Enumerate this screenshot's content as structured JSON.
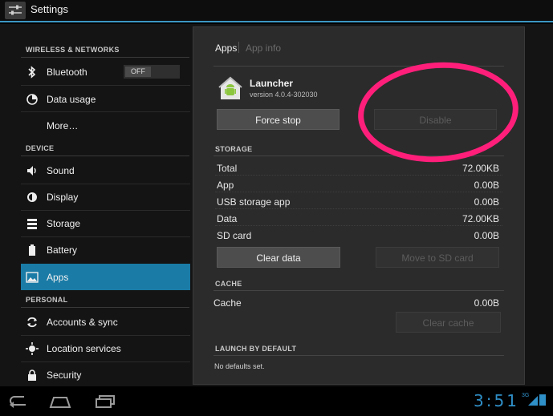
{
  "actionbar": {
    "title": "Settings",
    "icon": "settings-sliders-icon"
  },
  "sidebar": {
    "sections": [
      {
        "header": "WIRELESS & NETWORKS"
      },
      {
        "header": "DEVICE"
      },
      {
        "header": "PERSONAL"
      }
    ],
    "items": [
      {
        "label": "Bluetooth",
        "icon": "bluetooth-icon",
        "toggle": "OFF"
      },
      {
        "label": "Data usage",
        "icon": "data-usage-icon"
      },
      {
        "label": "More…"
      },
      {
        "label": "Sound",
        "icon": "speaker-icon"
      },
      {
        "label": "Display",
        "icon": "display-brightness-icon"
      },
      {
        "label": "Storage",
        "icon": "storage-icon"
      },
      {
        "label": "Battery",
        "icon": "battery-icon"
      },
      {
        "label": "Apps",
        "icon": "apps-icon",
        "selected": true
      },
      {
        "label": "Accounts & sync",
        "icon": "sync-icon"
      },
      {
        "label": "Location services",
        "icon": "location-icon"
      },
      {
        "label": "Security",
        "icon": "lock-icon"
      }
    ]
  },
  "panel": {
    "breadcrumb": {
      "current": "Apps",
      "next": "App info"
    },
    "app": {
      "name": "Launcher",
      "version": "version 4.0.4-302030",
      "icon": "android-launcher-icon"
    },
    "buttons": {
      "force_stop": "Force stop",
      "disable": "Disable"
    },
    "storage": {
      "header": "STORAGE",
      "rows": [
        {
          "label": "Total",
          "value": "72.00KB"
        },
        {
          "label": "App",
          "value": "0.00B"
        },
        {
          "label": "USB storage app",
          "value": "0.00B"
        },
        {
          "label": "Data",
          "value": "72.00KB"
        },
        {
          "label": "SD card",
          "value": "0.00B"
        }
      ],
      "clear_data": "Clear data",
      "move_to_sd": "Move to SD card"
    },
    "cache": {
      "header": "CACHE",
      "label": "Cache",
      "value": "0.00B",
      "clear_cache": "Clear cache"
    },
    "launch": {
      "header": "LAUNCH BY DEFAULT",
      "text": "No defaults set."
    }
  },
  "annotation": {
    "color": "#ff1f7a"
  },
  "systembar": {
    "time": "3:51",
    "network": "3G"
  },
  "colors": {
    "accent": "#1a7ba6",
    "highlight": "#3b97c4"
  }
}
